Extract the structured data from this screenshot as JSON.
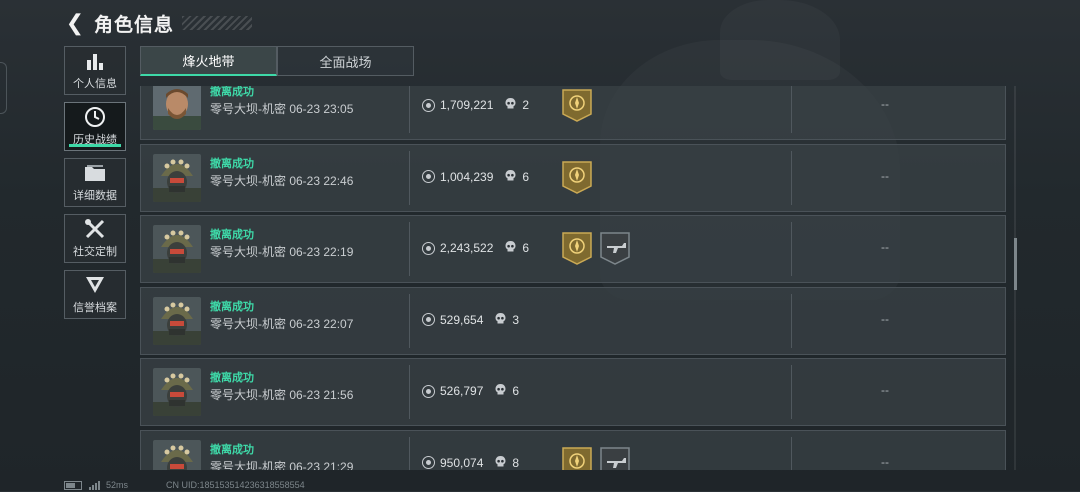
{
  "header": {
    "title": "角色信息"
  },
  "sidebar": {
    "items": [
      {
        "label": "个人信息",
        "icon": "bar-chart-icon",
        "active": false
      },
      {
        "label": "历史战绩",
        "icon": "history-clock-icon",
        "active": true
      },
      {
        "label": "详细数据",
        "icon": "folder-icon",
        "active": false
      },
      {
        "label": "社交定制",
        "icon": "tools-icon",
        "active": false
      },
      {
        "label": "信誉档案",
        "icon": "shield-emblem-icon",
        "active": false
      }
    ]
  },
  "tabs": [
    {
      "label": "烽火地带",
      "active": true
    },
    {
      "label": "全面战场",
      "active": false
    }
  ],
  "records": [
    {
      "status": "撤离成功",
      "map": "零号大坝-机密 06-23 23:05",
      "value": "1,709,221",
      "kills": "2",
      "badges": [
        "gold-emblem"
      ],
      "extra": "--",
      "avatar": "operator-beard"
    },
    {
      "status": "撤离成功",
      "map": "零号大坝-机密 06-23 22:46",
      "value": "1,004,239",
      "kills": "6",
      "badges": [
        "gold-emblem"
      ],
      "extra": "--",
      "avatar": "operator-helmet"
    },
    {
      "status": "撤离成功",
      "map": "零号大坝-机密 06-23 22:19",
      "value": "2,243,522",
      "kills": "6",
      "badges": [
        "gold-emblem",
        "gun-emblem"
      ],
      "extra": "--",
      "avatar": "operator-helmet"
    },
    {
      "status": "撤离成功",
      "map": "零号大坝-机密 06-23 22:07",
      "value": "529,654",
      "kills": "3",
      "badges": [],
      "extra": "--",
      "avatar": "operator-helmet"
    },
    {
      "status": "撤离成功",
      "map": "零号大坝-机密 06-23 21:56",
      "value": "526,797",
      "kills": "6",
      "badges": [],
      "extra": "--",
      "avatar": "operator-helmet"
    },
    {
      "status": "撤离成功",
      "map": "零号大坝-机密 06-23 21:29",
      "value": "950,074",
      "kills": "8",
      "badges": [
        "gold-emblem",
        "gun-emblem"
      ],
      "extra": "--",
      "avatar": "operator-helmet"
    }
  ],
  "statusbar": {
    "ping": "52ms",
    "uid": "CN UID:1851535142363185585​54"
  },
  "colors": {
    "accent": "#3ed9a8",
    "badge_gold": "#b89a4a"
  }
}
